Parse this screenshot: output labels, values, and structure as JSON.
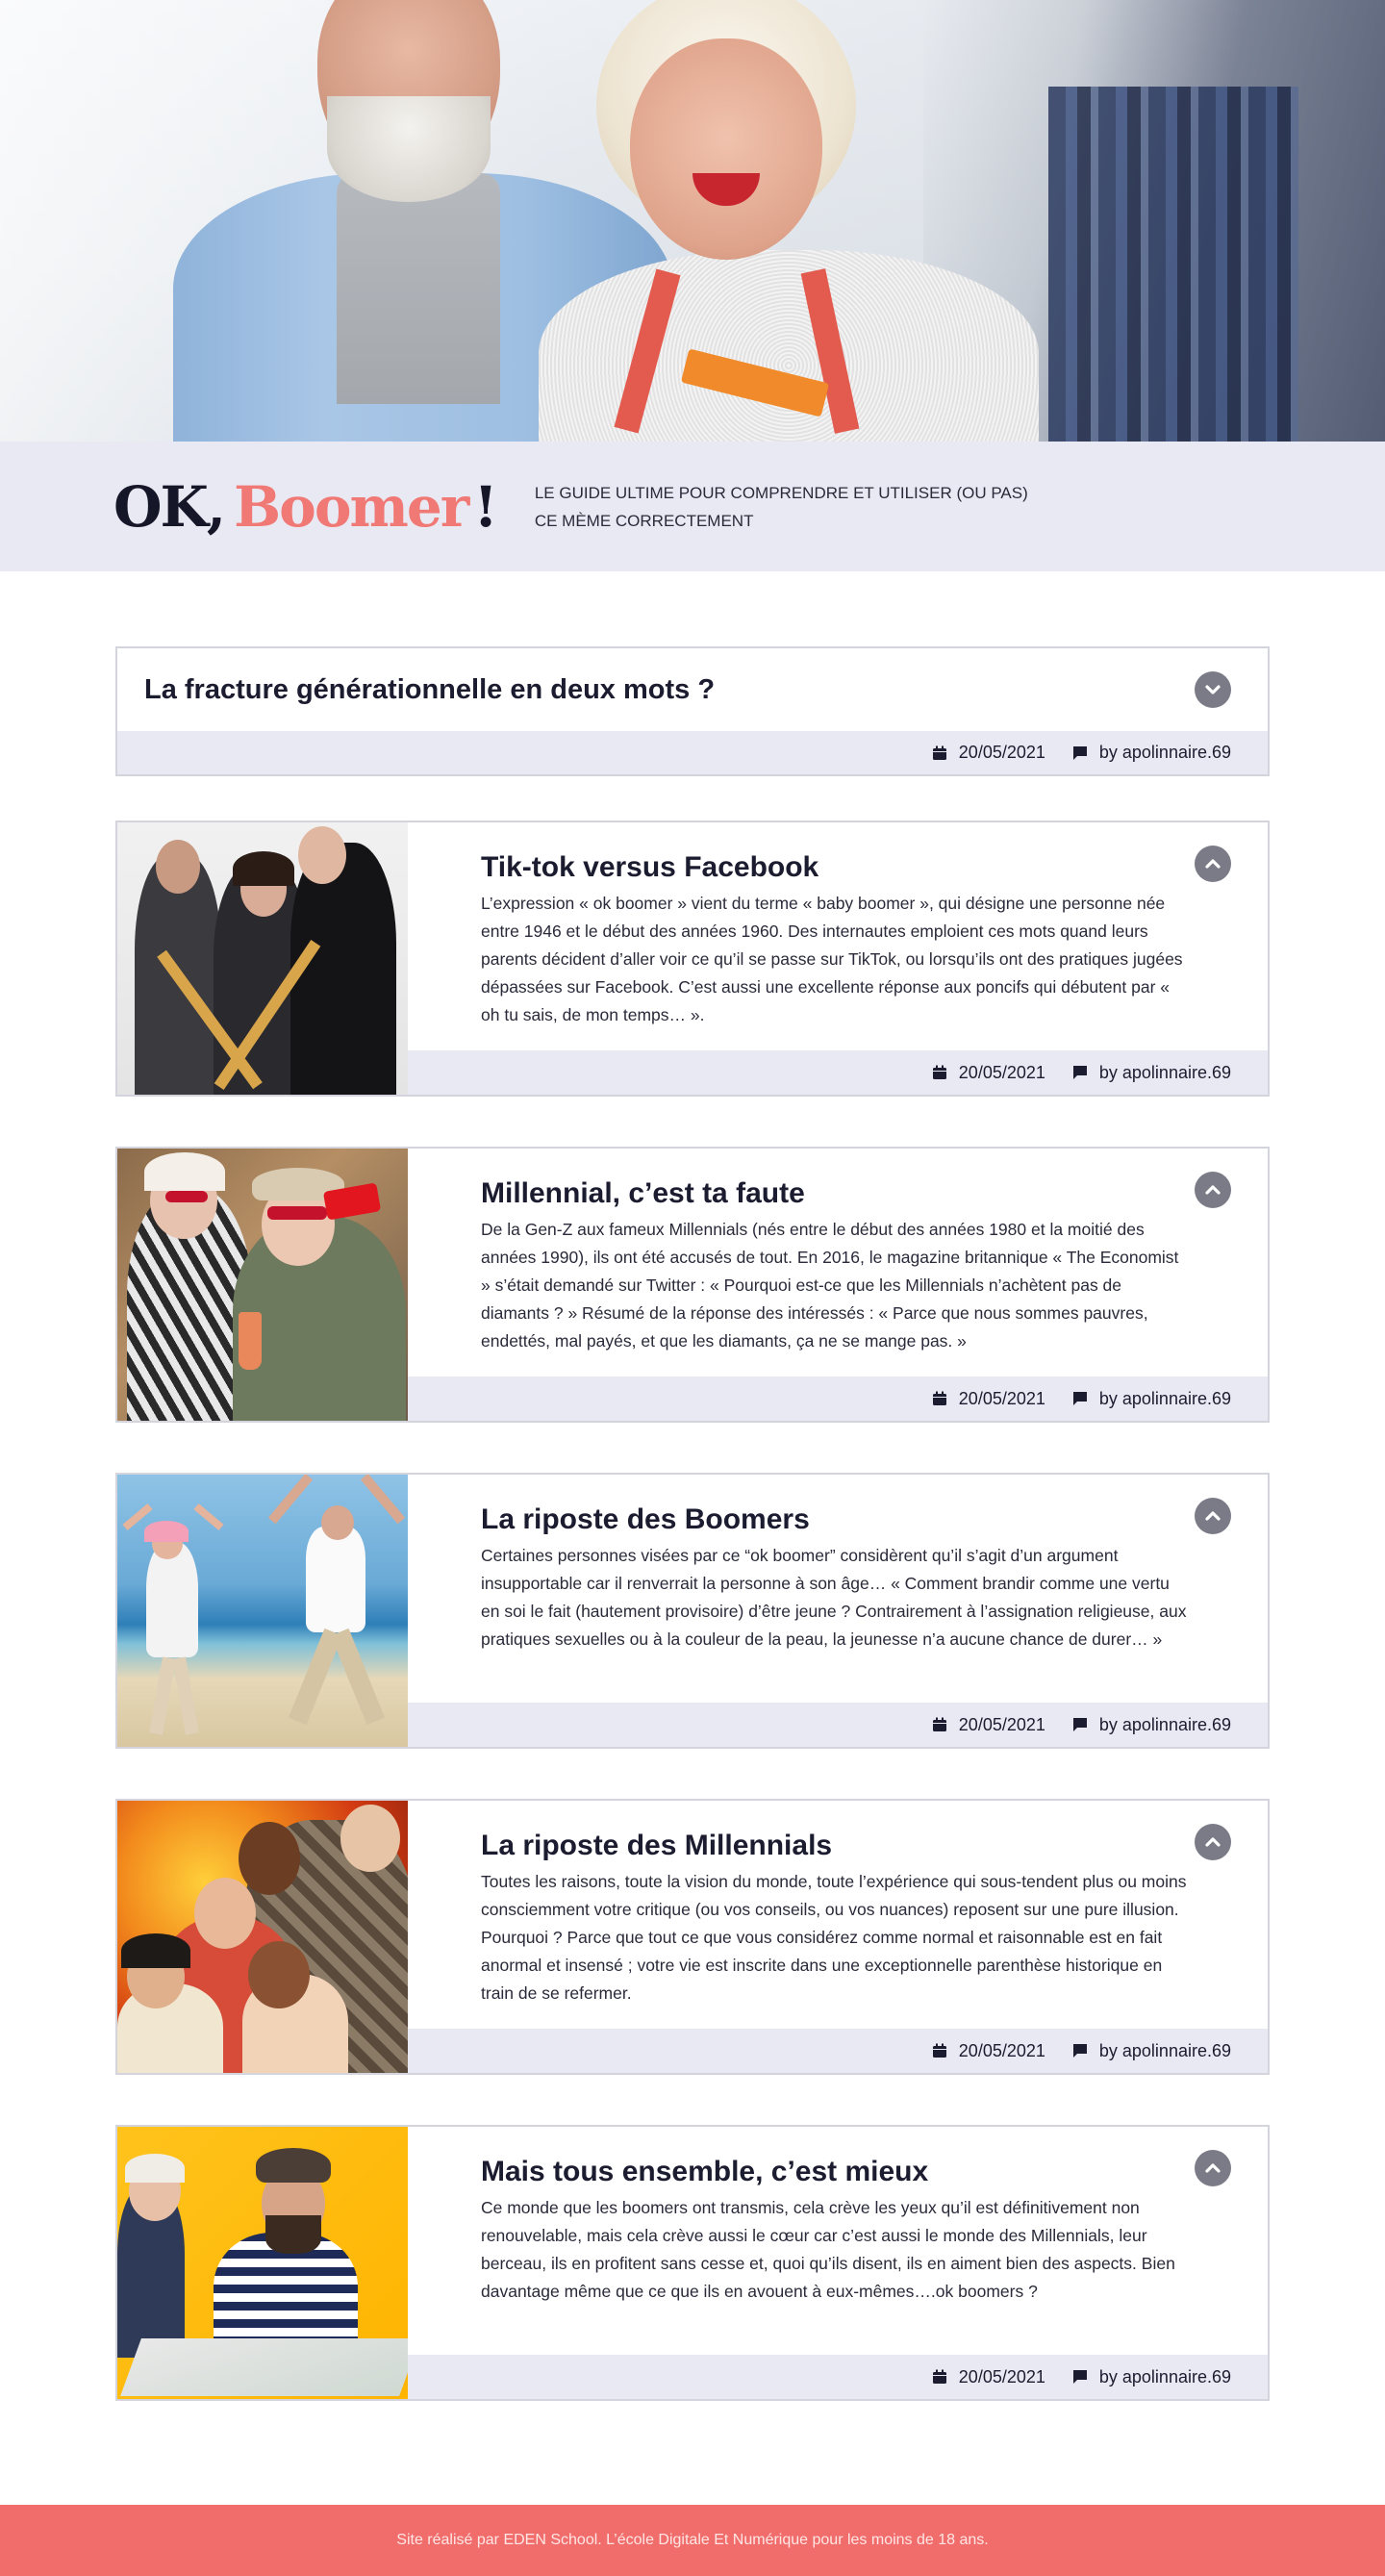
{
  "header": {
    "logo_ok": "OK,",
    "logo_boomer": "Boomer",
    "logo_bang": "!",
    "tagline_line1": "LE GUIDE ULTIME POUR COMPRENDRE ET UTILISER (OU PAS)",
    "tagline_line2": "CE MÈME CORRECTEMENT"
  },
  "intro": {
    "title": "La fracture générationnelle en deux mots ?",
    "date": "20/05/2021",
    "author": "by apolinnaire.69"
  },
  "articles": [
    {
      "title": "Tik-tok versus Facebook",
      "text": "L’expression « ok boomer » vient du terme « baby boomer », qui désigne une personne née entre 1946 et le début des années 1960. Des internautes emploient ces mots quand leurs parents décident d’aller voir ce qu’il se passe sur TikTok, ou lorsqu’ils ont des pratiques jugées dépassées sur Facebook. C’est aussi une excellente réponse aux poncifs qui débutent par « oh tu sais, de mon temps… ».",
      "date": "20/05/2021",
      "author": "by apolinnaire.69"
    },
    {
      "title": "Millennial, c’est ta faute",
      "text": "De la Gen-Z aux fameux Millennials (nés entre le début des années 1980 et la moitié des années 1990), ils ont été accusés de tout. En 2016, le magazine britannique « The Economist » s’était demandé sur Twitter : « Pourquoi est-ce que les Millennials n’achètent pas de diamants ? » Résumé de la réponse des intéressés : « Parce que nous sommes pauvres, endettés, mal payés, et que les diamants, ça ne se mange pas. »",
      "date": "20/05/2021",
      "author": "by apolinnaire.69"
    },
    {
      "title": "La riposte des Boomers",
      "text": "Certaines personnes visées par ce “ok boomer” considèrent qu’il s’agit d’un argument insupportable car il renverrait la personne à son âge… « Comment brandir comme une vertu en soi le fait (hautement provisoire) d’être jeune ? Contrairement à l’assignation religieuse, aux pratiques sexuelles ou à la couleur de la peau, la jeunesse n’a aucune chance de durer… »",
      "date": "20/05/2021",
      "author": "by apolinnaire.69"
    },
    {
      "title": "La riposte des Millennials",
      "text": "Toutes les raisons, toute la vision du monde, toute l’expérience qui sous-tendent plus ou moins consciemment votre critique (ou vos conseils, ou vos nuances) reposent sur une pure illusion. Pourquoi ? Parce que tout ce que vous considérez comme normal et raisonnable est en fait anormal et insensé ; votre vie est inscrite dans une exceptionnelle parenthèse historique en train de se refermer.",
      "date": "20/05/2021",
      "author": "by apolinnaire.69"
    },
    {
      "title": "Mais tous ensemble, c’est mieux",
      "text": "Ce monde que les boomers ont transmis, cela crève les yeux qu’il est définitivement non renouvelable, mais cela crève aussi le cœur car c’est aussi le monde des Millennials, leur berceau, ils en profitent sans cesse et, quoi qu’ils disent, ils en aiment bien des aspects. Bien davantage même que ce que ils en avouent à eux-mêmes….ok boomers ?",
      "date": "20/05/2021",
      "author": "by apolinnaire.69"
    }
  ],
  "footer": {
    "text": "Site réalisé par EDEN School. L’école Digitale Et Numérique pour les moins de 18 ans."
  },
  "colors": {
    "accent": "#f07975",
    "band": "#e9e9f3",
    "footer": "#f06d6c",
    "dark": "#161629"
  },
  "icons": {
    "toggle_down": "chevron-down-icon",
    "toggle_up": "chevron-up-icon",
    "date": "calendar-icon",
    "author": "comment-icon"
  }
}
